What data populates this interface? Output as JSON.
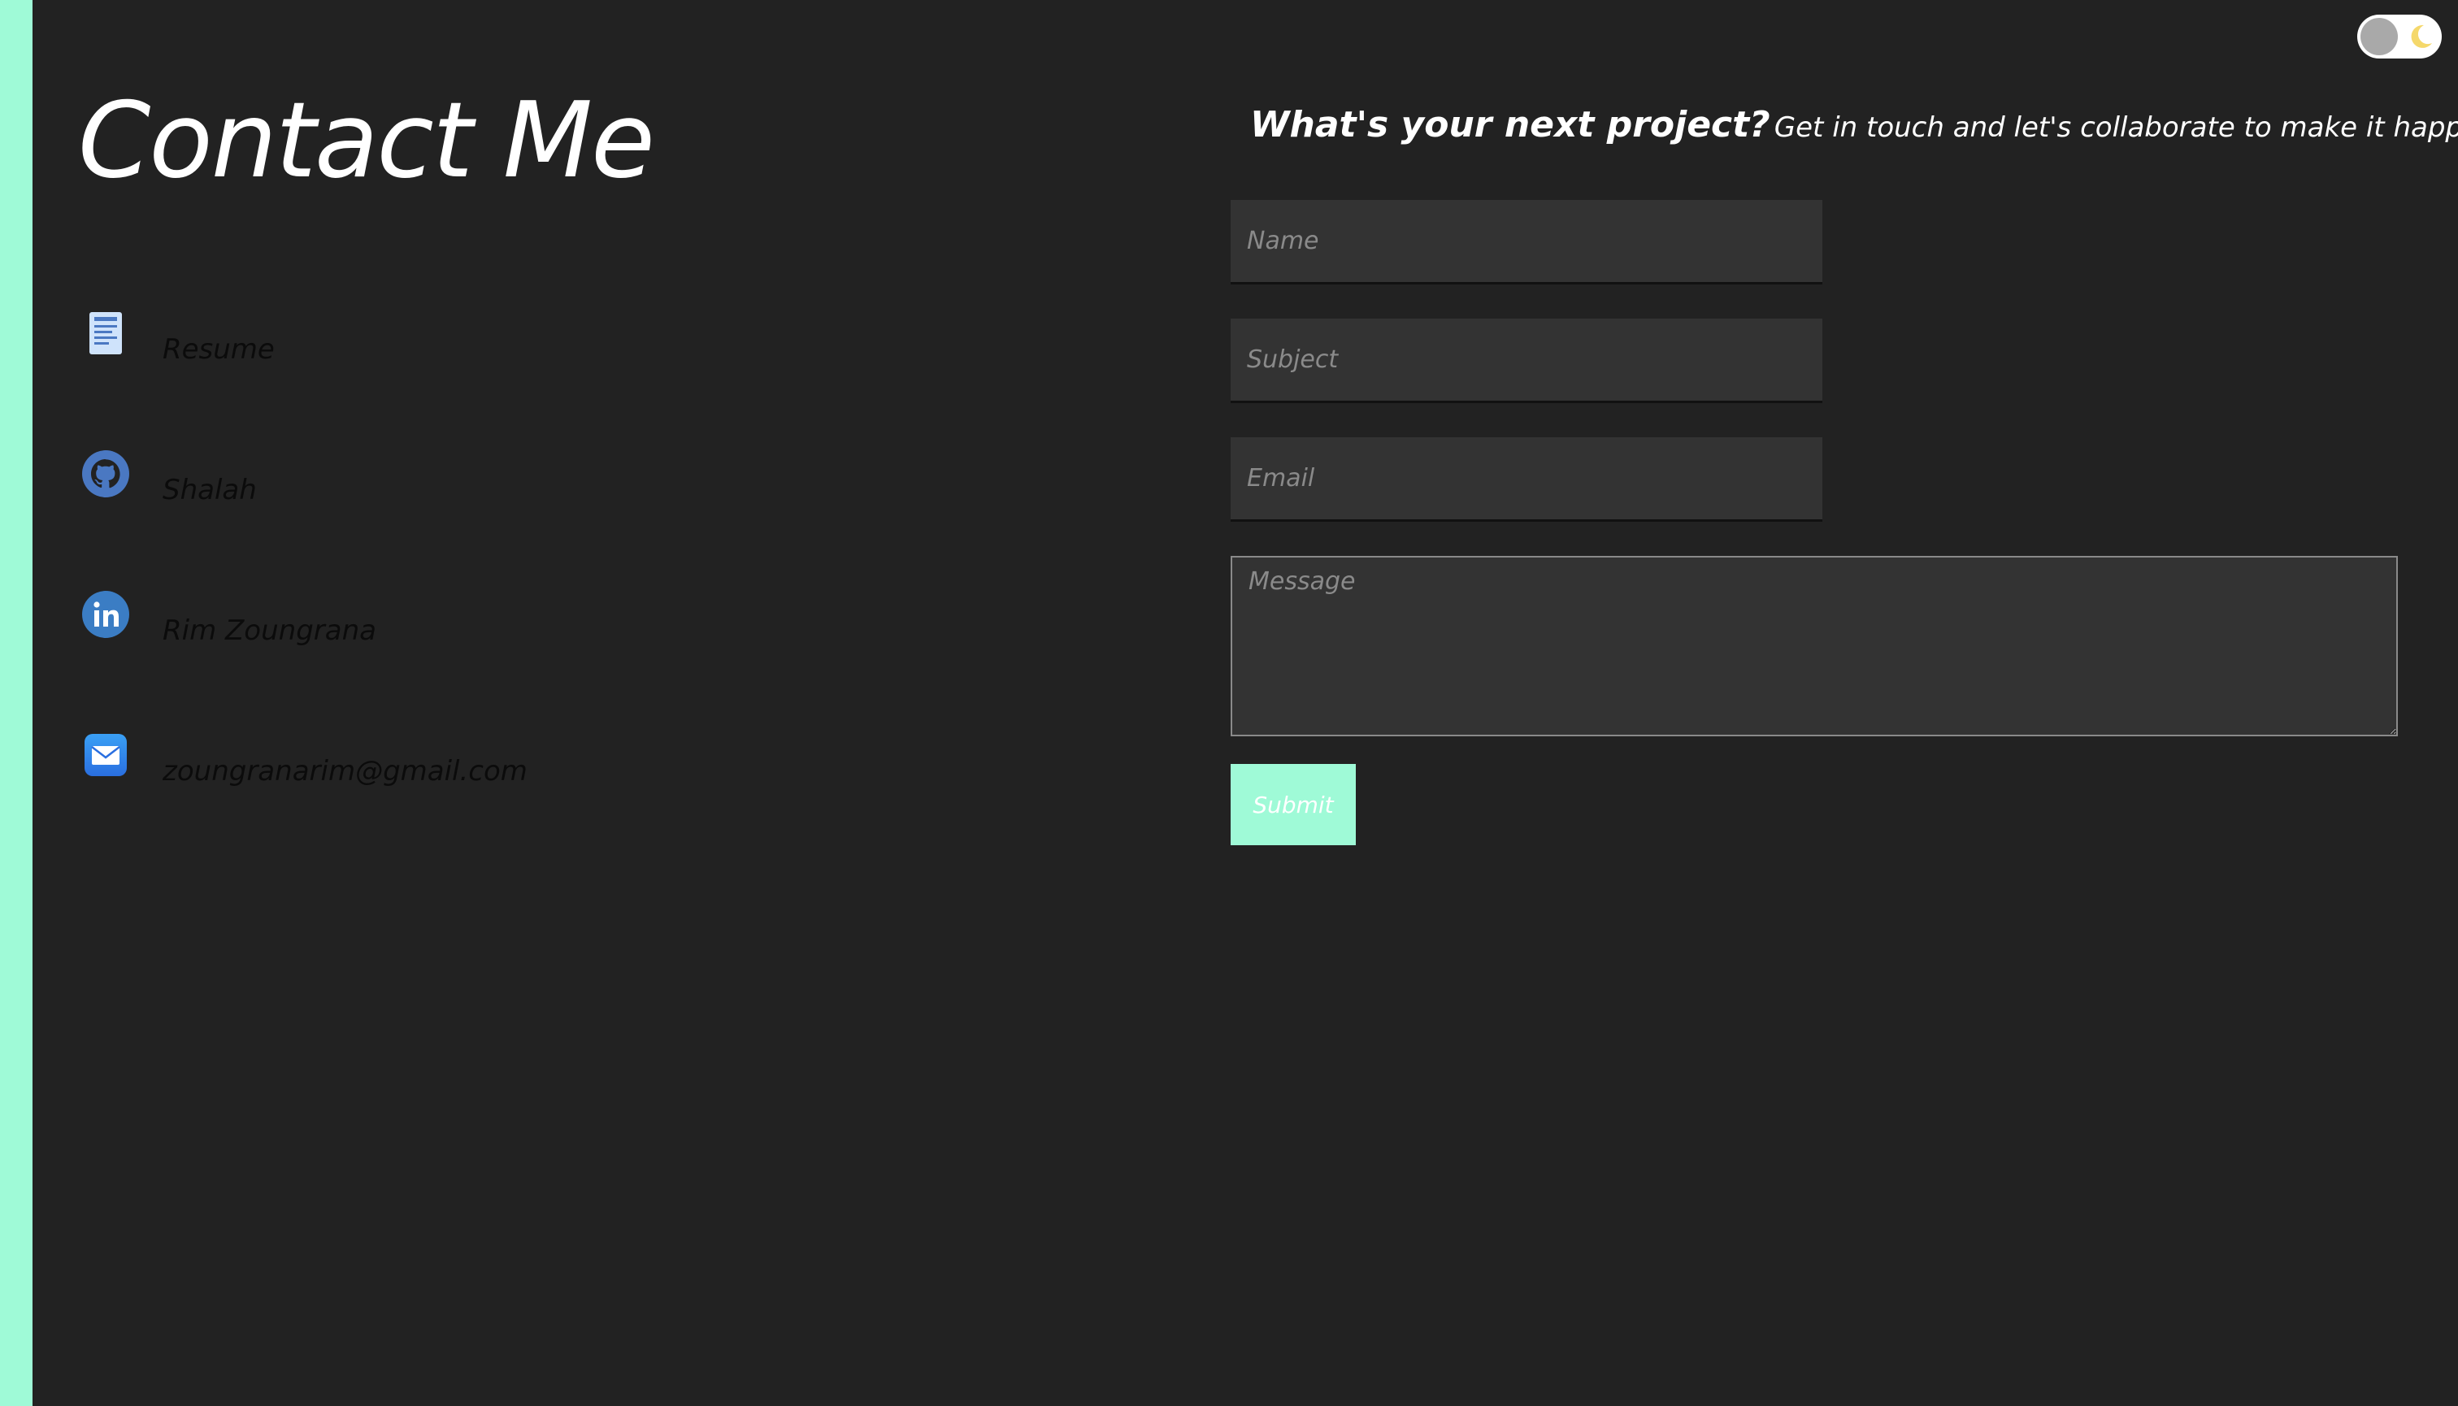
{
  "colors": {
    "background": "#222222",
    "accent": "#9ffad7",
    "input_bg": "#333333",
    "text": "#ffffff",
    "contact_text": "#0b0b0b"
  },
  "header": {
    "title": "Contact Me"
  },
  "contacts": [
    {
      "icon": "document-icon",
      "label": "Resume"
    },
    {
      "icon": "github-icon",
      "label": "Shalah"
    },
    {
      "icon": "linkedin-icon",
      "label": "Rim Zoungrana"
    },
    {
      "icon": "mail-icon",
      "label": "zoungranarim@gmail.com"
    }
  ],
  "theme_toggle": {
    "icon": "moon-icon",
    "state": "dark"
  },
  "form": {
    "tagline_strong": "What's your next project?",
    "tagline_rest": "Get in touch and let's collaborate to make it happen",
    "name_placeholder": "Name",
    "subject_placeholder": "Subject",
    "email_placeholder": "Email",
    "message_placeholder": "Message",
    "submit_label": "Submit"
  }
}
